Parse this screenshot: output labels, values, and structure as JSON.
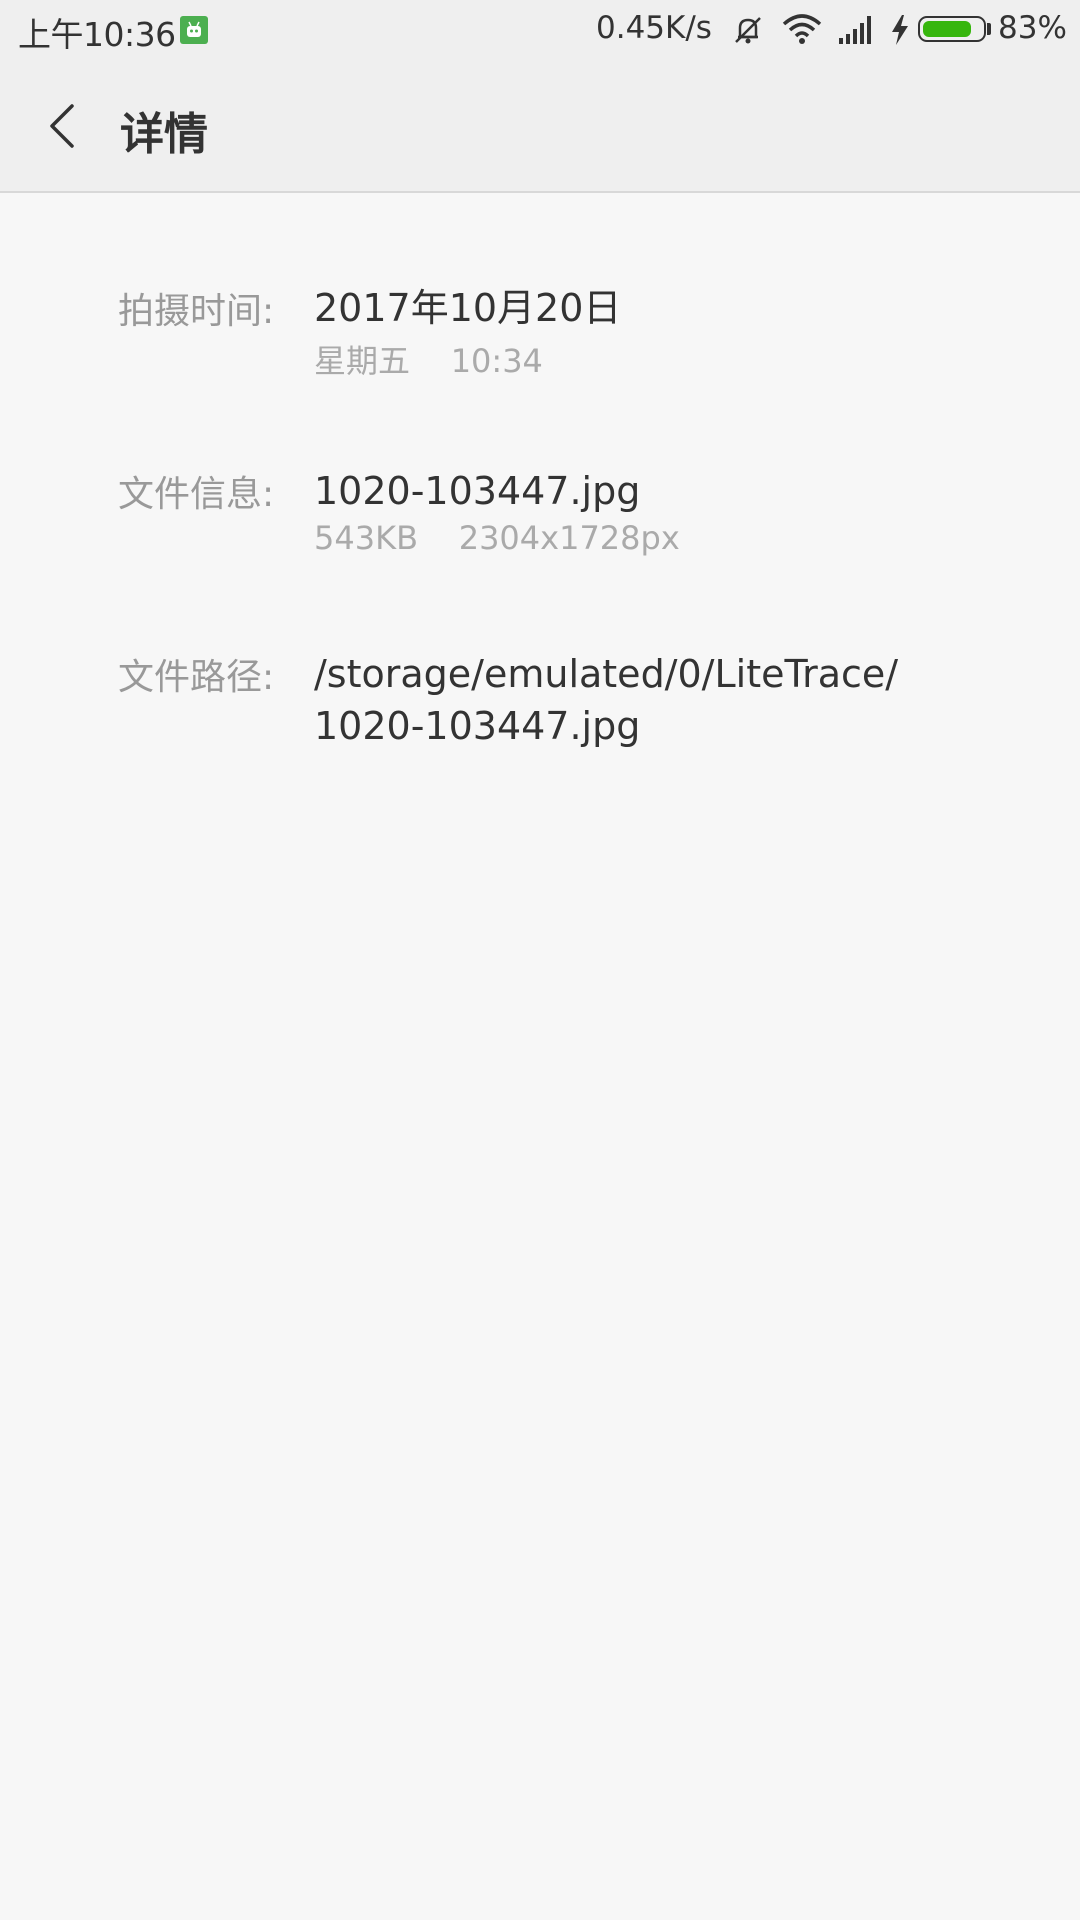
{
  "status_bar": {
    "time": "上午10:36",
    "net_speed": "0.45K/s",
    "battery_pct": "83%",
    "battery_level": 0.83,
    "icons": [
      "android-notification-icon",
      "mute-bell-icon",
      "wifi-icon",
      "cell-signal-icon",
      "charging-bolt-icon",
      "battery-icon"
    ]
  },
  "header": {
    "back_icon": "chevron-left-icon",
    "title": "详情"
  },
  "details": {
    "capture_time": {
      "label": "拍摄时间:",
      "date": "2017年10月20日",
      "sub": "星期五    10:34"
    },
    "file_info": {
      "label": "文件信息:",
      "name": "1020-103447.jpg",
      "sub": "543KB    2304x1728px"
    },
    "file_path": {
      "label": "文件路径:",
      "path_line1": "/storage/emulated/0/LiteTrace/",
      "path_line2": "1020-103447.jpg"
    }
  }
}
